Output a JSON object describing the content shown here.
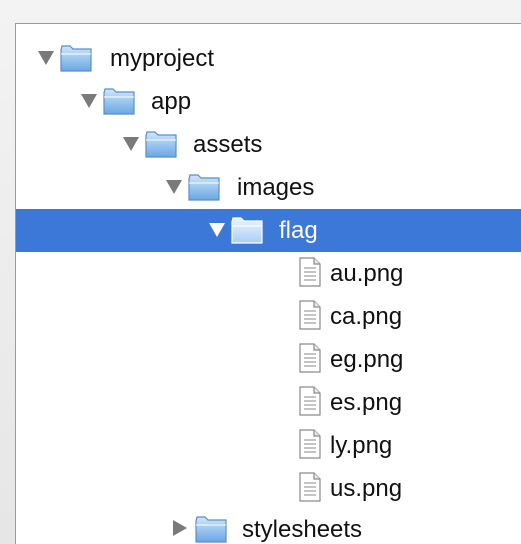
{
  "tree": {
    "root": {
      "label": "myproject",
      "icon": "folder-icon",
      "expanded": true
    },
    "app": {
      "label": "app",
      "icon": "folder-icon",
      "expanded": true
    },
    "assets": {
      "label": "assets",
      "icon": "folder-icon",
      "expanded": true
    },
    "images": {
      "label": "images",
      "icon": "folder-icon",
      "expanded": true
    },
    "flag": {
      "label": "flag",
      "icon": "folder-icon",
      "expanded": true,
      "selected": true
    },
    "files": [
      {
        "label": "au.png",
        "icon": "file-icon"
      },
      {
        "label": "ca.png",
        "icon": "file-icon"
      },
      {
        "label": "eg.png",
        "icon": "file-icon"
      },
      {
        "label": "es.png",
        "icon": "file-icon"
      },
      {
        "label": "ly.png",
        "icon": "file-icon"
      },
      {
        "label": "us.png",
        "icon": "file-icon"
      }
    ],
    "stylesheets": {
      "label": "stylesheets",
      "icon": "folder-icon",
      "expanded": false
    }
  },
  "colors": {
    "selection": "#3c78d8",
    "folder": "#7fb6ea",
    "disclosure": "#7a7a7a"
  }
}
